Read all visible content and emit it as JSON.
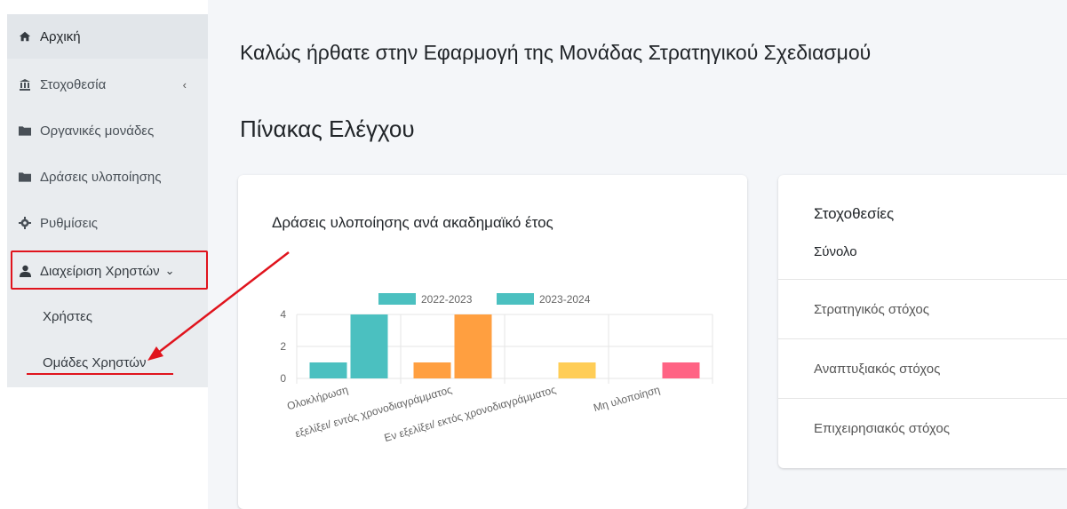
{
  "sidebar": {
    "items": [
      {
        "label": "Αρχική",
        "icon": "home-icon"
      },
      {
        "label": "Στοχοθεσία",
        "icon": "institution-icon"
      },
      {
        "label": "Οργανικές μονάδες",
        "icon": "folder-icon"
      },
      {
        "label": "Δράσεις υλοποίησης",
        "icon": "folder-icon"
      },
      {
        "label": "Ρυθμίσεις",
        "icon": "gear-icon"
      },
      {
        "label": "Διαχείριση Χρηστών",
        "icon": "user-icon"
      }
    ],
    "chevron_left": "‹",
    "chevron_down": "⌄",
    "sub_items": [
      {
        "label": "Χρήστες"
      },
      {
        "label": "Ομάδες Χρηστών"
      }
    ]
  },
  "main": {
    "welcome": "Καλώς ήρθατε στην Εφαρμογή της Μονάδας Στρατηγικού Σχεδιασμού",
    "dashboard_title": "Πίνακας Ελέγχου"
  },
  "chart_card": {
    "title": "Δράσεις υλοποίησης ανά ακαδημαϊκό έτος"
  },
  "stats_card": {
    "title": "Στοχοθεσίες",
    "total_label": "Σύνολο",
    "rows": [
      {
        "label": "Στρατηγικός στόχος"
      },
      {
        "label": "Αναπτυξιακός στόχος"
      },
      {
        "label": "Επιχειρησιακός στόχος"
      }
    ]
  },
  "colors": {
    "teal": "#4bc0c0",
    "orange": "#ff9f40",
    "yellow": "#ffcd56",
    "pink": "#ff6384",
    "annotation_red": "#e0141d"
  },
  "chart_data": {
    "type": "bar",
    "categories": [
      "Ολοκλήρωση",
      "εξελίξει/ εντός χρονοδιαγράμματος",
      "Εν εξελίξει/ εκτός χρονοδιαγράμματος",
      "Μη υλοποίηση"
    ],
    "series": [
      {
        "name": "2022-2023",
        "values": [
          1,
          1,
          0,
          0
        ]
      },
      {
        "name": "2023-2024",
        "values": [
          4,
          4,
          1,
          1
        ]
      }
    ],
    "bar_colors": [
      "#4bc0c0",
      "#ff9f40",
      "#ffcd56",
      "#ff6384"
    ],
    "legend_color": "#4bc0c0",
    "yticks": [
      0,
      2,
      4
    ],
    "ylim": [
      0,
      4
    ],
    "grid": true,
    "legend_position": "top"
  }
}
